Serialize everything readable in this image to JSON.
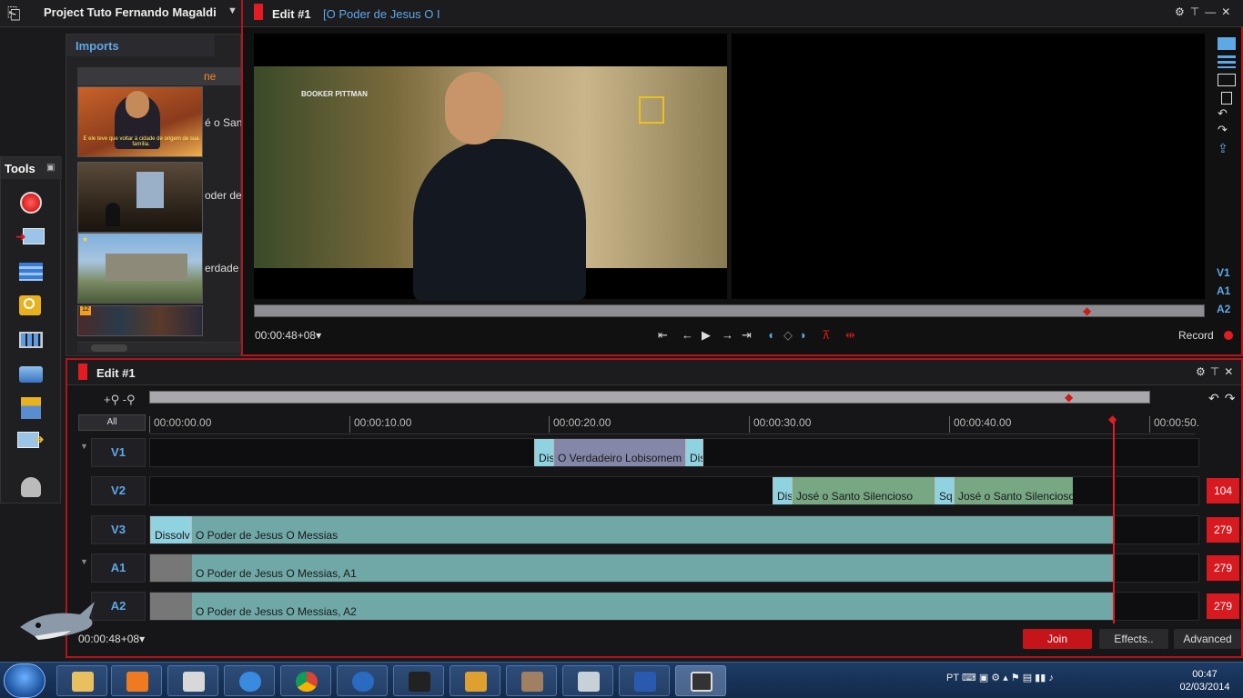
{
  "project": {
    "title": "Project Tuto Fernando Magaldi",
    "dropdown": "▼"
  },
  "imports": {
    "title": "Imports",
    "column_header": "ne",
    "items": [
      {
        "label": "é o San",
        "subtitle": "E ele teve que voltar à cidade de origem de sua família."
      },
      {
        "label": "oder de"
      },
      {
        "label": "erdade"
      },
      {
        "label": ""
      }
    ],
    "thumb_badge": "12"
  },
  "tools": {
    "title": "Tools",
    "pin": "▣"
  },
  "viewer": {
    "title": "Edit #1",
    "subtitle": "[O Poder de Jesus   O I",
    "caption": "BOOKER PITTMAN",
    "timecode": "00:00:48+08",
    "tc_dropdown": "▾",
    "record_label": "Record",
    "tracks": [
      "V1",
      "A1",
      "A2"
    ],
    "transport": [
      "⏮",
      "◀",
      "▶",
      "▶",
      "⏭"
    ]
  },
  "timeline": {
    "title": "Edit #1",
    "zoom_controls": "+⚲ -⚲",
    "all_label": "All",
    "ruler": [
      "00:00:00.00",
      "00:00:10.00",
      "00:00:20.00",
      "00:00:30.00",
      "00:00:40.00",
      "00:00:50."
    ],
    "tracks": [
      {
        "name": "V1",
        "counter": "",
        "clips": [
          {
            "text": "Dis",
            "kind": "trans"
          },
          {
            "text": "O Verdadeiro Lobisomem",
            "kind": "blue"
          },
          {
            "text": "Dis",
            "kind": "trans"
          }
        ]
      },
      {
        "name": "V2",
        "counter": "104",
        "clips": [
          {
            "text": "Dis",
            "kind": "trans"
          },
          {
            "text": "José o Santo Silencioso",
            "kind": "green"
          },
          {
            "text": "Sq",
            "kind": "trans"
          },
          {
            "text": "José o Santo Silencioso",
            "kind": "green"
          }
        ]
      },
      {
        "name": "V3",
        "counter": "279",
        "clips": [
          {
            "text": "Dissolv",
            "kind": "trans"
          },
          {
            "text": "O Poder de Jesus   O Messias",
            "kind": "teal"
          }
        ]
      },
      {
        "name": "A1",
        "counter": "279",
        "clips": [
          {
            "text": "",
            "kind": "grey"
          },
          {
            "text": "O Poder de Jesus   O Messias, A1",
            "kind": "teal"
          }
        ]
      },
      {
        "name": "A2",
        "counter": "279",
        "clips": [
          {
            "text": "",
            "kind": "grey"
          },
          {
            "text": "O Poder de Jesus   O Messias, A2",
            "kind": "teal"
          }
        ]
      }
    ],
    "timecode": "00:00:48+08",
    "tc_dropdown": "▾",
    "buttons": {
      "join": "Join",
      "effects": "Effects..",
      "advanced": "Advanced"
    }
  },
  "taskbar": {
    "apps": [
      "explorer",
      "media-player",
      "media-player-classic",
      "internet-explorer",
      "chrome",
      "windows-media-center",
      "horse-app",
      "pencil-app",
      "photo-app",
      "calculator",
      "sigi-app",
      "video-editor"
    ],
    "tray_lang": "PT",
    "clock_time": "00:47",
    "clock_date": "02/03/2014"
  },
  "colors": {
    "accent_red": "#e31b23",
    "accent_blue": "#5ea8e6",
    "clip_teal": "#6fa8a6",
    "clip_green": "#77a783",
    "clip_blue": "#8488a8",
    "transition": "#8fd2e0"
  }
}
